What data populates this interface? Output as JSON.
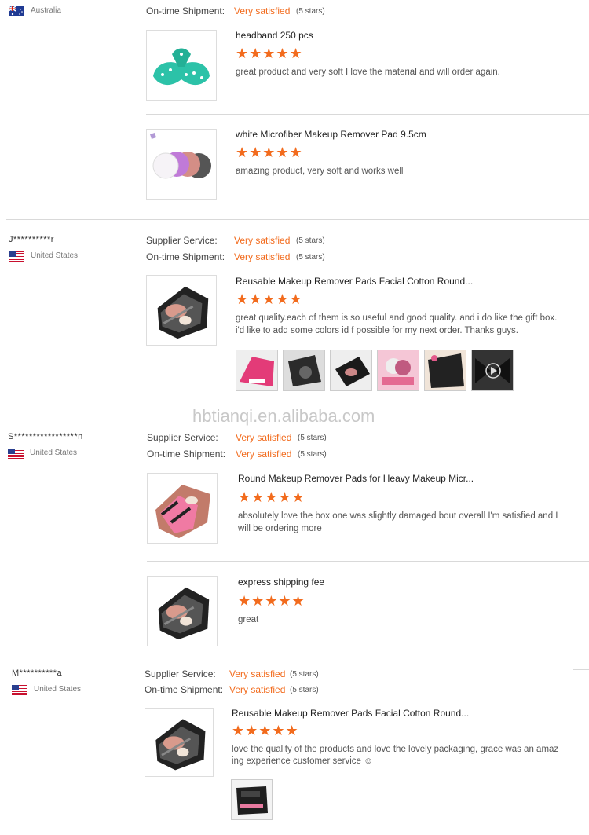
{
  "labels": {
    "supplier_service": "Supplier Service:",
    "ontime_shipment": "On-time Shipment:"
  },
  "watermark": "hbtianqi.en.alibaba.com",
  "reviews": [
    {
      "user": "",
      "country": "Australia",
      "ontime": "Very satisfied",
      "ontime_stars": "(5 stars)",
      "products": [
        {
          "title": "headband 250 pcs",
          "rating": 5,
          "stars": "★★★★★",
          "text": "great product and very soft I love the material and will order again."
        },
        {
          "title": "white Microfiber Makeup Remover Pad 9.5cm",
          "rating": 5,
          "stars": "★★★★★",
          "text": "amazing product, very soft and works well"
        }
      ]
    },
    {
      "user": "J**********r",
      "country": "United States",
      "supplier": "Very satisfied",
      "supplier_stars": "(5 stars)",
      "ontime": "Very satisfied",
      "ontime_stars": "(5 stars)",
      "products": [
        {
          "title": "Reusable Makeup Remover Pads Facial Cotton Round...",
          "rating": 5,
          "stars": "★★★★★",
          "text1": "great quality.each of them is so useful and good quality. and i do like the gift box.",
          "text2": "i'd like to add some colors id f possible for my next order. Thanks guys."
        }
      ]
    },
    {
      "user": "S*****************n",
      "country": "United States",
      "supplier": "Very satisfied",
      "supplier_stars": "(5 stars)",
      "ontime": "Very satisfied",
      "ontime_stars": "(5 stars)",
      "products": [
        {
          "title": "Round Makeup Remover Pads for Heavy Makeup Micr...",
          "rating": 5,
          "stars": "★★★★★",
          "text1": "absolutely love the box one was slightly damaged bout overall I'm satisfied and I",
          "text2": "will be ordering more"
        },
        {
          "title": "express shipping fee",
          "rating": 5,
          "stars": "★★★★★",
          "text": "great"
        }
      ]
    },
    {
      "user": "M**********a",
      "country": "United States",
      "supplier": "Very satisfied",
      "supplier_stars": "(5 stars)",
      "ontime": "Very satisfied",
      "ontime_stars": "(5 stars)",
      "products": [
        {
          "title": "Reusable Makeup Remover Pads Facial Cotton Round...",
          "rating": 5,
          "stars": "★★★★★",
          "text1": "love the quality of the products and love the lovely packaging, grace was an amaz",
          "text2": "ing experience customer service ☺"
        }
      ]
    }
  ],
  "icons": [
    "flag-au-icon",
    "flag-us-icon",
    "star-icon",
    "play-icon"
  ],
  "colors": {
    "accent": "#f26b1d",
    "divider": "#d9d9d9",
    "text": "#333333"
  }
}
